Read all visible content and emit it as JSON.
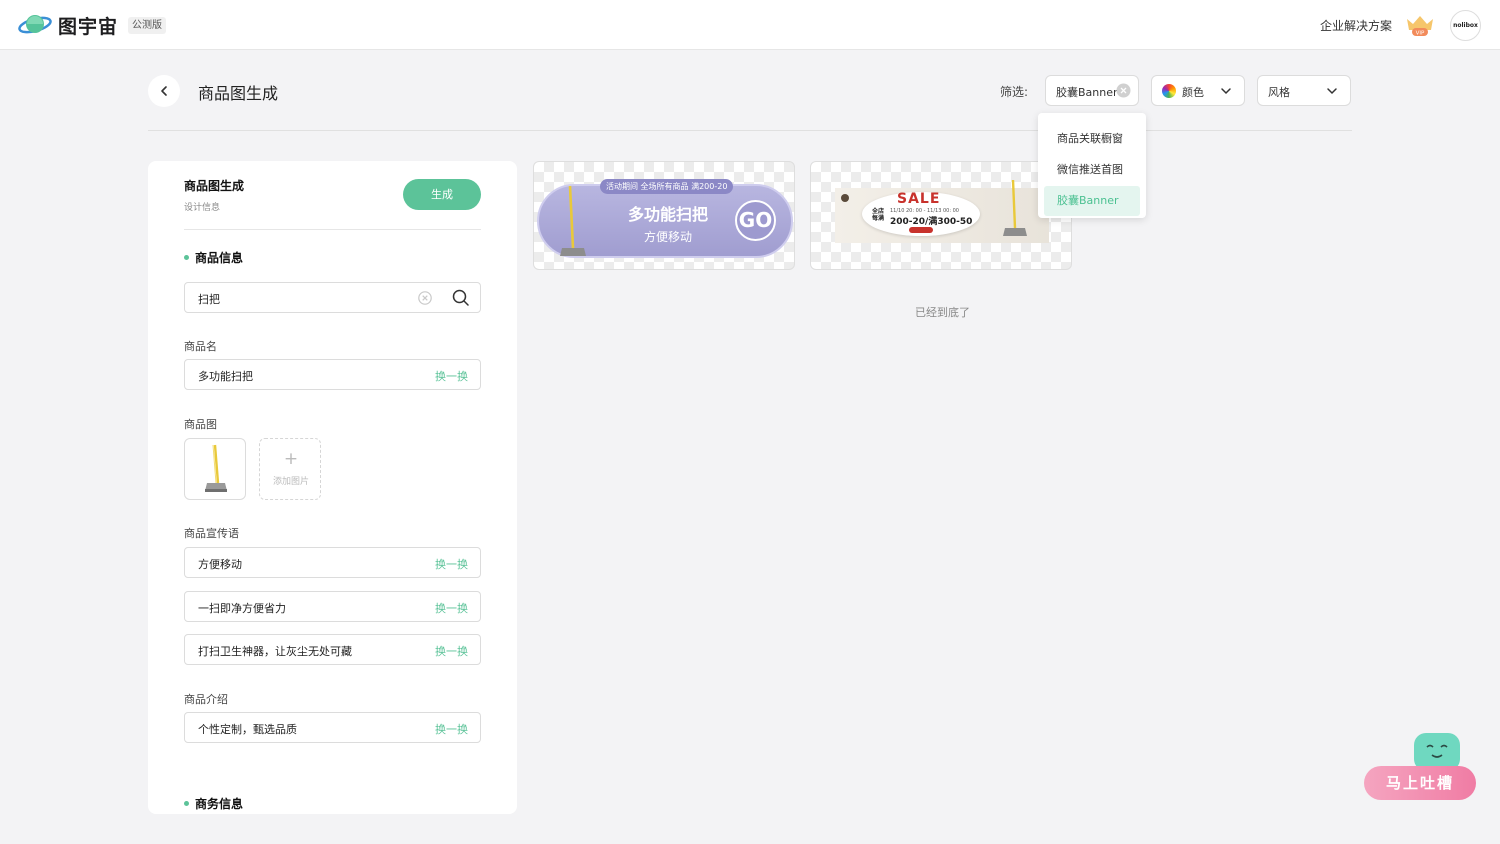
{
  "topbar": {
    "logo_text": "图宇宙",
    "beta_badge": "公测版",
    "enterprise_link": "企业解决方案",
    "vip_label": "VIP",
    "avatar_text": "nolibox"
  },
  "header": {
    "title": "商品图生成",
    "filter_label": "筛选:",
    "filter_chip": "胶囊Banner",
    "color_dropdown": "颜色",
    "style_dropdown": "风格"
  },
  "dropdown_menu": {
    "items": [
      {
        "label": "商品关联橱窗",
        "active": false
      },
      {
        "label": "微信推送首图",
        "active": false
      },
      {
        "label": "胶囊Banner",
        "active": true
      }
    ]
  },
  "panel": {
    "title": "商品图生成",
    "subtitle": "设计信息",
    "generate_label": "生成",
    "section_product": "商品信息",
    "search_value": "扫把",
    "name_label": "商品名",
    "name_value": "多功能扫把",
    "image_label": "商品图",
    "add_image_label": "添加图片",
    "slogan_label": "商品宣传语",
    "slogans": [
      "方便移动",
      "一扫即净方便省力",
      "打扫卫生神器，让灰尘无处可藏"
    ],
    "intro_label": "商品介绍",
    "intro_value": "个性定制，甄选品质",
    "swap_label": "换一换",
    "section_business": "商务信息"
  },
  "results": {
    "card1": {
      "tag": "活动期间 全场所有商品 满200-20",
      "main": "多功能扫把",
      "sub": "方便移动",
      "go": "GO"
    },
    "card2": {
      "sale": "SALE",
      "left_text": "全店\n每满",
      "date": "11/10 20: 00 - 11/13 00: 00",
      "amount": "200-20/满300-50"
    },
    "bottom_note": "已经到底了"
  },
  "feedback": {
    "label": "马上吐槽"
  },
  "colors": {
    "accent": "#5cc399",
    "capsule": "#a09dd0",
    "sale_red": "#c8322c",
    "feedback_pink": "#f07ca4"
  }
}
